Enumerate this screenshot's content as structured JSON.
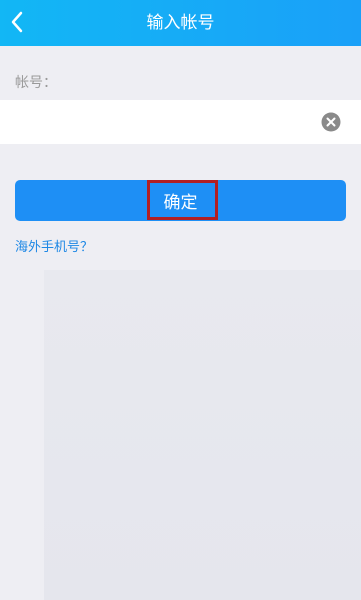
{
  "header": {
    "title": "输入帐号",
    "back_icon": "chevron-left-icon"
  },
  "form": {
    "account_label": "帐号：",
    "account_value": "",
    "account_placeholder": "",
    "clear_icon": "clear-circle-icon"
  },
  "actions": {
    "confirm_label": "确定",
    "overseas_link": "海外手机号？"
  },
  "colors": {
    "header": "#12b7f5",
    "primary_button": "#1e8ff5",
    "link": "#1e88e5",
    "highlight_box": "#b01e22",
    "background": "#eeeef3"
  }
}
